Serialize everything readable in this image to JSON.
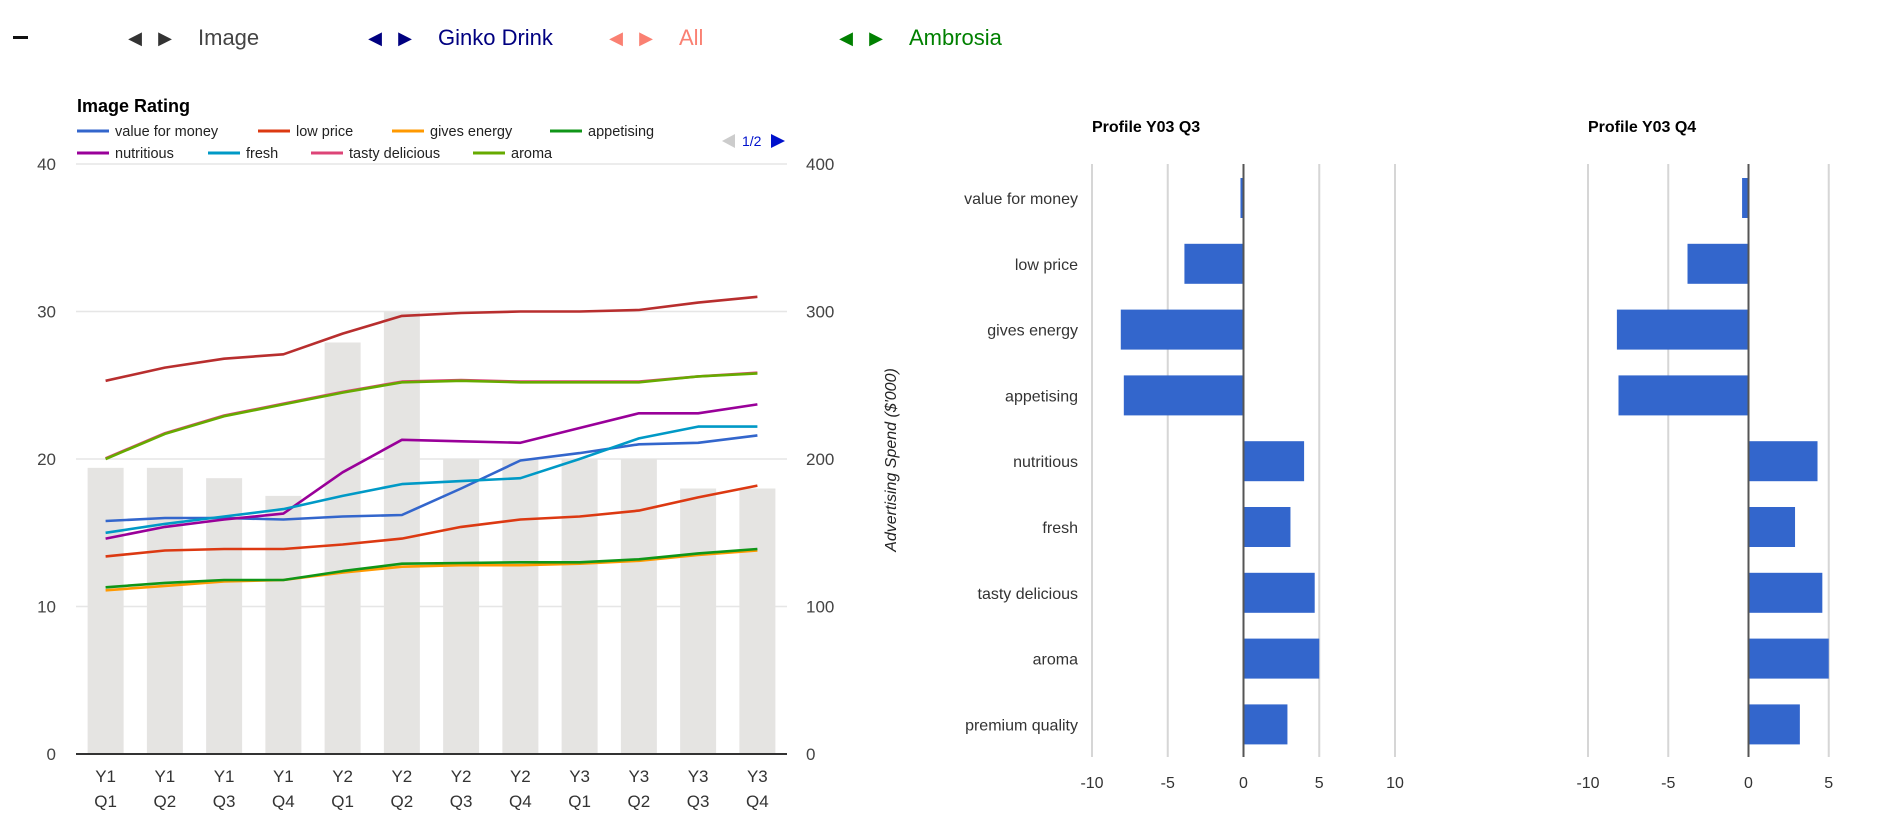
{
  "header": {
    "collapse_icon": "minus-icon",
    "groups": [
      {
        "label": "Image",
        "color": "#444444",
        "prev_icon": "triangle-left-icon",
        "next_icon": "triangle-right-icon"
      },
      {
        "label": "Ginko Drink",
        "color": "#000080",
        "prev_icon": "triangle-left-icon",
        "next_icon": "triangle-right-icon"
      },
      {
        "label": "All",
        "color": "#fa8072",
        "prev_icon": "triangle-left-icon",
        "next_icon": "triangle-right-icon"
      },
      {
        "label": "Ambrosia",
        "color": "#008000",
        "prev_icon": "triangle-left-icon",
        "next_icon": "triangle-right-icon"
      }
    ]
  },
  "chart_data": [
    {
      "type": "line",
      "title": "Image Rating",
      "legend_position": "top",
      "legend_page": "1/2",
      "categories": [
        "Y1 Q1",
        "Y1 Q2",
        "Y1 Q3",
        "Y1 Q4",
        "Y2 Q1",
        "Y2 Q2",
        "Y2 Q3",
        "Y2 Q4",
        "Y3 Q1",
        "Y3 Q2",
        "Y3 Q3",
        "Y3 Q4"
      ],
      "category_lines": [
        [
          "Y1",
          "Q1"
        ],
        [
          "Y1",
          "Q2"
        ],
        [
          "Y1",
          "Q3"
        ],
        [
          "Y1",
          "Q4"
        ],
        [
          "Y2",
          "Q1"
        ],
        [
          "Y2",
          "Q2"
        ],
        [
          "Y2",
          "Q3"
        ],
        [
          "Y2",
          "Q4"
        ],
        [
          "Y3",
          "Q1"
        ],
        [
          "Y3",
          "Q2"
        ],
        [
          "Y3",
          "Q3"
        ],
        [
          "Y3",
          "Q4"
        ]
      ],
      "ylim": [
        0,
        40
      ],
      "yticks": [
        0,
        10,
        20,
        30,
        40
      ],
      "y2label": "Advertising Spend ($'000)",
      "y2lim": [
        0,
        400
      ],
      "y2ticks": [
        0,
        100,
        200,
        300,
        400
      ],
      "grid": true,
      "bars": {
        "name": "Advertising Spend ($'000)",
        "axis": "right",
        "color": "#e5e4e2",
        "values": [
          194,
          194,
          187,
          175,
          279,
          300,
          200,
          200,
          200,
          200,
          180,
          180
        ]
      },
      "series": [
        {
          "name": "value for money",
          "color": "#3366cc",
          "in_legend": true,
          "values": [
            15.8,
            16.0,
            16.0,
            15.9,
            16.1,
            16.2,
            18.0,
            19.9,
            20.4,
            21.0,
            21.1,
            21.6
          ]
        },
        {
          "name": "low price",
          "color": "#dc3912",
          "in_legend": true,
          "values": [
            13.4,
            13.8,
            13.9,
            13.9,
            14.2,
            14.6,
            15.4,
            15.9,
            16.1,
            16.5,
            17.4,
            18.2
          ]
        },
        {
          "name": "gives energy",
          "color": "#ff9900",
          "in_legend": true,
          "values": [
            11.1,
            11.4,
            11.7,
            11.8,
            12.3,
            12.7,
            12.8,
            12.8,
            12.9,
            13.1,
            13.5,
            13.8
          ]
        },
        {
          "name": "appetising",
          "color": "#109618",
          "in_legend": true,
          "values": [
            11.3,
            11.6,
            11.8,
            11.8,
            12.4,
            12.9,
            12.95,
            13.0,
            13.0,
            13.2,
            13.6,
            13.9
          ]
        },
        {
          "name": "nutritious",
          "color": "#990099",
          "in_legend": true,
          "values": [
            14.6,
            15.4,
            15.9,
            16.3,
            19.1,
            21.3,
            21.2,
            21.1,
            22.1,
            23.1,
            23.1,
            23.7
          ]
        },
        {
          "name": "fresh",
          "color": "#0099c6",
          "in_legend": true,
          "values": [
            15.0,
            15.6,
            16.1,
            16.6,
            17.5,
            18.3,
            18.5,
            18.7,
            20.0,
            21.4,
            22.2,
            22.2
          ]
        },
        {
          "name": "tasty delicious",
          "color": "#dd4477",
          "in_legend": true,
          "values": [
            20.05,
            21.75,
            22.95,
            23.75,
            24.55,
            25.25,
            25.35,
            25.25,
            25.25,
            25.25,
            25.6,
            25.85
          ]
        },
        {
          "name": "aroma",
          "color": "#66aa00",
          "in_legend": true,
          "values": [
            20.0,
            21.7,
            22.9,
            23.7,
            24.5,
            25.2,
            25.3,
            25.2,
            25.2,
            25.2,
            25.6,
            25.8
          ]
        },
        {
          "name": "premium quality",
          "color": "#b82e2e",
          "in_legend": false,
          "values": [
            25.3,
            26.2,
            26.8,
            27.1,
            28.5,
            29.7,
            29.9,
            30.0,
            30.0,
            30.1,
            30.6,
            31.0
          ]
        }
      ]
    },
    {
      "type": "bar",
      "orientation": "horizontal",
      "title": "Profile Y03 Q3",
      "categories": [
        "value for money",
        "low price",
        "gives energy",
        "appetising",
        "nutritious",
        "fresh",
        "tasty delicious",
        "aroma",
        "premium quality"
      ],
      "values": [
        -0.2,
        -3.9,
        -8.1,
        -7.9,
        4.0,
        3.1,
        4.7,
        5.0,
        2.9
      ],
      "color": "#3366cc",
      "xlim": [
        -10,
        10
      ],
      "xticks": [
        -10,
        -5,
        0,
        5,
        10
      ],
      "grid": true
    },
    {
      "type": "bar",
      "orientation": "horizontal",
      "title": "Profile Y03 Q4",
      "categories": [
        "value for money",
        "low price",
        "gives energy",
        "appetising",
        "nutritious",
        "fresh",
        "tasty delicious",
        "aroma",
        "premium quality"
      ],
      "values": [
        -0.4,
        -3.8,
        -8.2,
        -8.1,
        4.3,
        2.9,
        4.6,
        5.0,
        3.2
      ],
      "color": "#3366cc",
      "xlim": [
        -10,
        10
      ],
      "xticks": [
        -10,
        -5,
        0,
        5
      ],
      "grid": true
    }
  ]
}
